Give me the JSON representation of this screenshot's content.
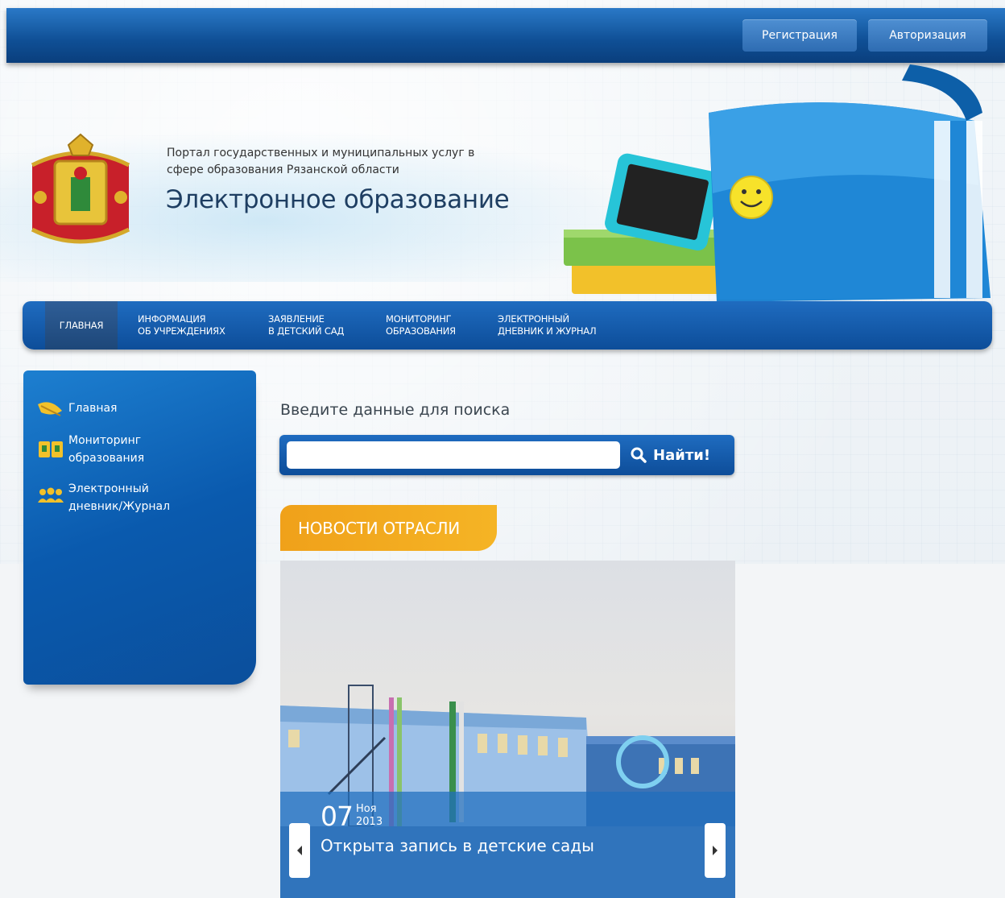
{
  "header": {
    "register_label": "Регистрация",
    "login_label": "Авторизация"
  },
  "banner": {
    "subtitle_line1": "Портал государственных и муниципальных услуг в",
    "subtitle_line2": "сфере образования Рязанской области",
    "title": "Электронное образование"
  },
  "nav": {
    "items": [
      {
        "line1": "Главная",
        "line2": ""
      },
      {
        "line1": "Информация",
        "line2": "об учреждениях"
      },
      {
        "line1": "Заявление",
        "line2": "в детский сад"
      },
      {
        "line1": "Мониторинг",
        "line2": "образования"
      },
      {
        "line1": "Электронный",
        "line2": "дневник и журнал"
      }
    ]
  },
  "sidebar": {
    "items": [
      {
        "line1": "Главная",
        "line2": "",
        "icon": "leaf-icon"
      },
      {
        "line1": "Мониторинг",
        "line2": "образования",
        "icon": "book-icon"
      },
      {
        "line1": "Электронный",
        "line2": "дневник/Журнал",
        "icon": "people-icon"
      }
    ]
  },
  "search": {
    "label": "Введите данные для поиска",
    "value": "",
    "placeholder": "",
    "button_label": "Найти!"
  },
  "news": {
    "tab_label": "Новости отрасли",
    "slide": {
      "day": "07",
      "month": "Ноя",
      "year": "2013",
      "title": "Открыта запись в детские сады"
    }
  },
  "colors": {
    "primary_blue": "#0d4d99",
    "accent_orange": "#f0a11a"
  }
}
